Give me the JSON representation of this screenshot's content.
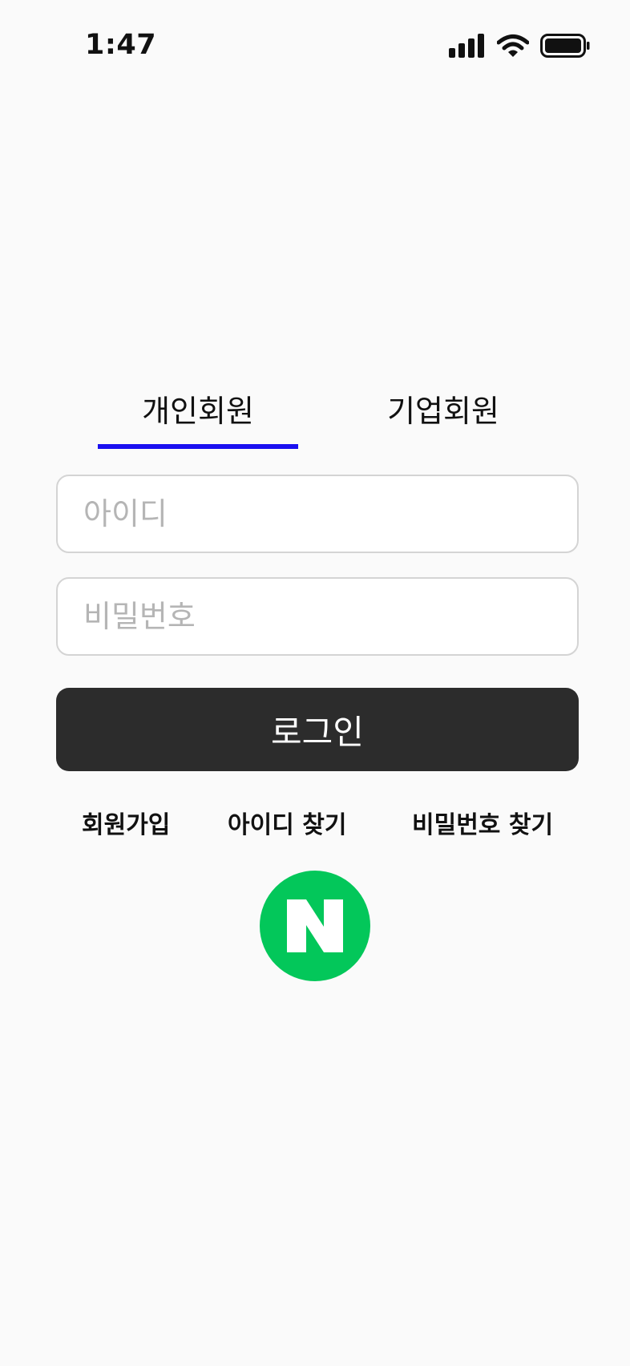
{
  "status_bar": {
    "time": "1:47",
    "icons": [
      "cellular-signal-icon",
      "wifi-icon",
      "battery-icon"
    ]
  },
  "tabs": [
    {
      "label": "개인회원",
      "selected": true
    },
    {
      "label": "기업회원",
      "selected": false
    }
  ],
  "form": {
    "id_value": "",
    "id_placeholder": "아이디",
    "password_value": "",
    "password_placeholder": "비밀번호",
    "login_label": "로그인"
  },
  "links": {
    "signup": "회원가입",
    "find_id": "아이디 찾기",
    "find_password": "비밀번호 찾기"
  },
  "social_login": {
    "icon": "naver-logo-icon",
    "color": "#03c75a"
  },
  "colors": {
    "tab_underline": "#1a0ff0",
    "login_button": "#2c2c2c",
    "background": "#fafafa"
  }
}
